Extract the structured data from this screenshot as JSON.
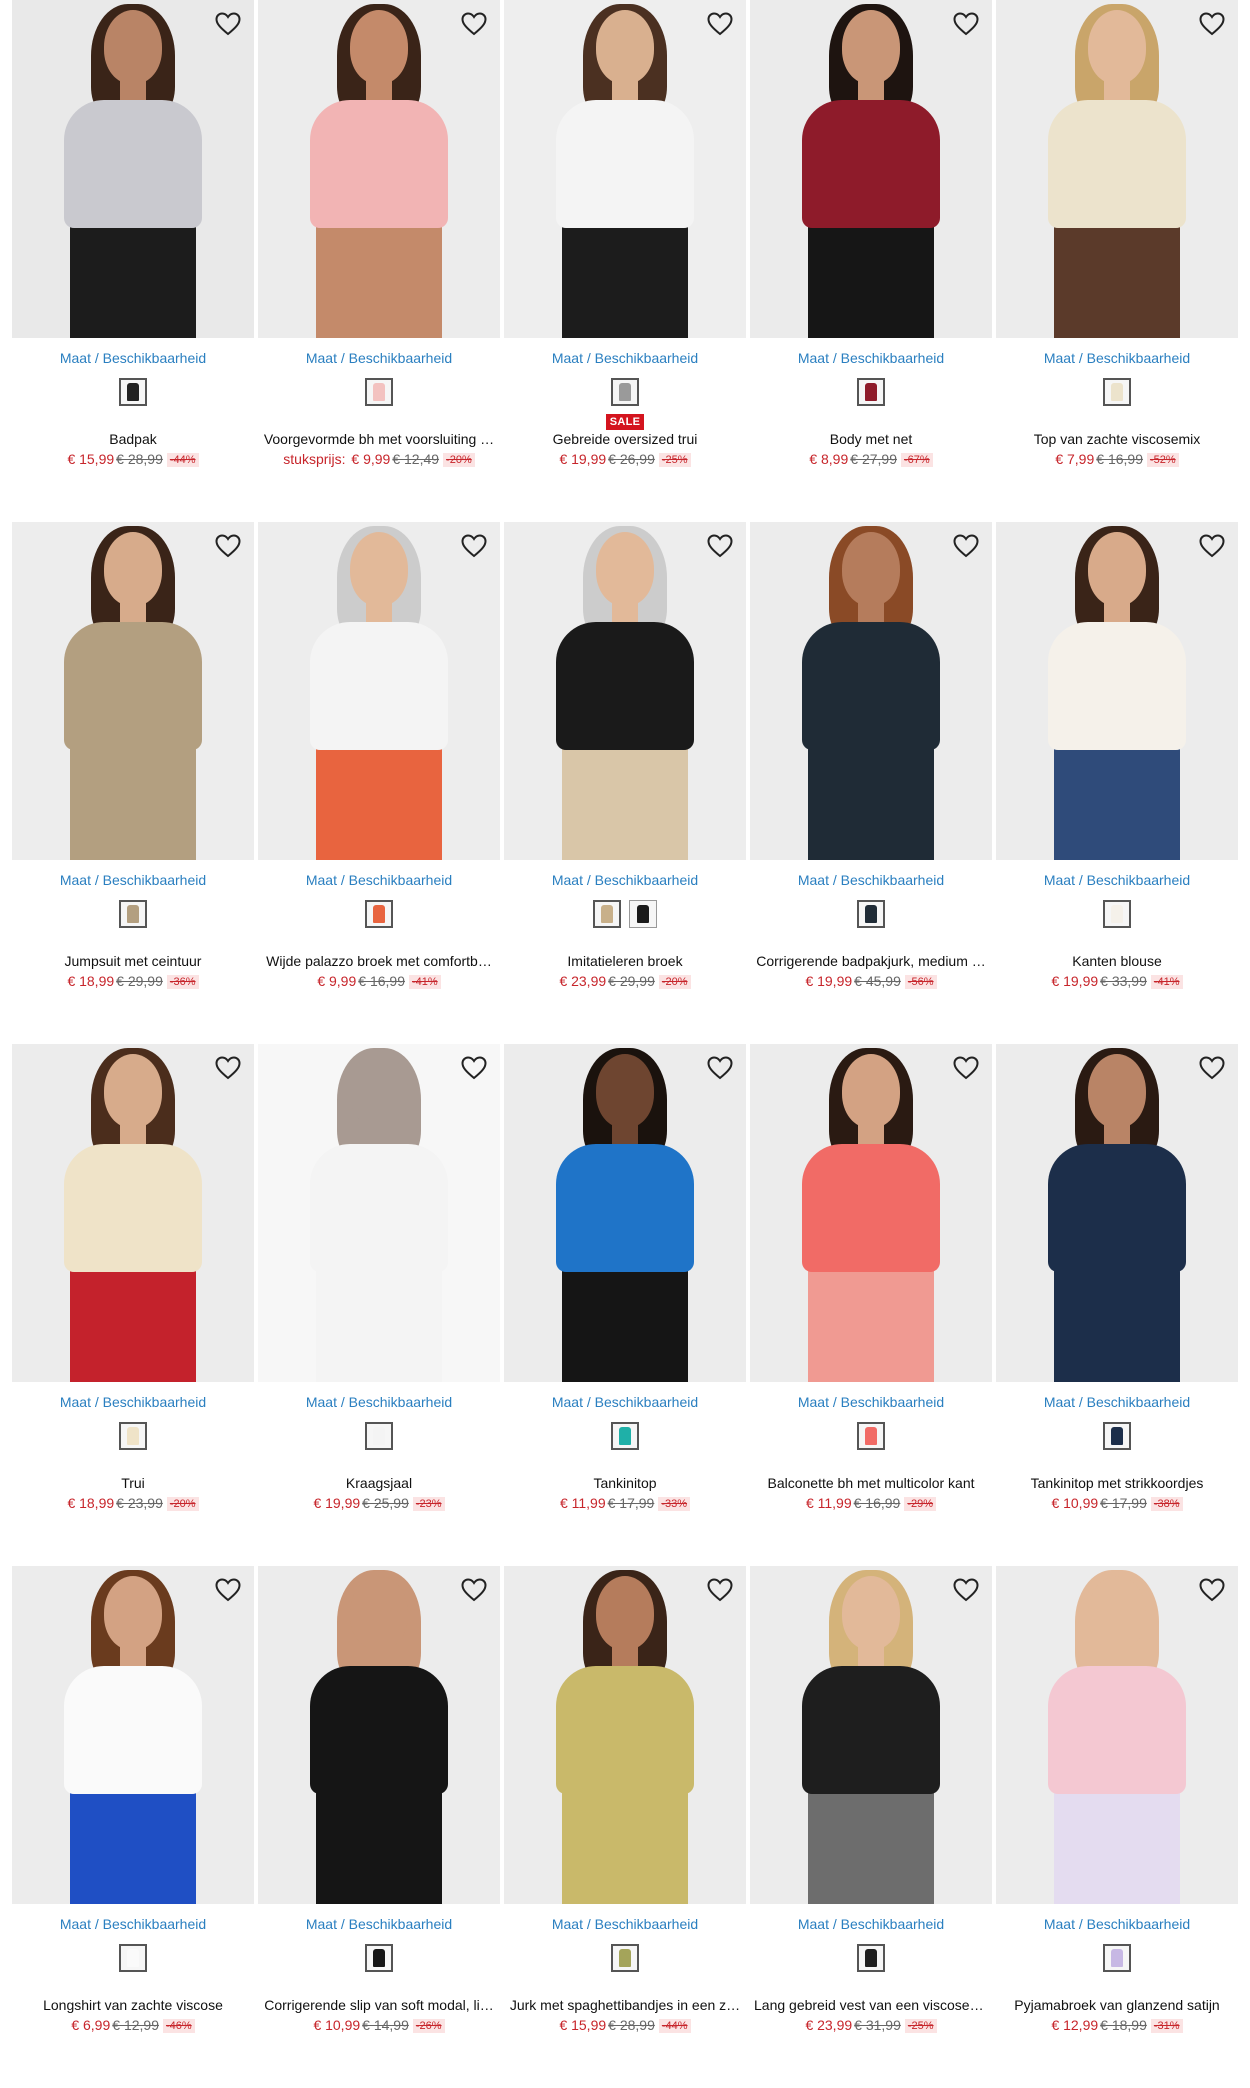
{
  "grid": {
    "size_link_label": "Maat / Beschikbaarheid",
    "products": [
      {
        "title": "Badpak",
        "price_prefix": "",
        "price": "€ 15,99",
        "old_price": "€ 28,99",
        "discount": "-44%",
        "badge": "",
        "img_bg": "#e9e9e9",
        "top": "#c9c9cf",
        "bottom": "#1c1c1c",
        "skin": "#b98466",
        "hair": "#3a2418",
        "swatches": [
          {
            "color": "#222222",
            "selected": true
          }
        ]
      },
      {
        "title": "Voorgevormde bh met voorsluiting …",
        "price_prefix": "stuksprijs:",
        "price": "€ 9,99",
        "old_price": "€ 12,49",
        "discount": "-20%",
        "badge": "",
        "img_bg": "#ececec",
        "top": "#f2b4b4",
        "bottom": "#c48a6a",
        "skin": "#c48a6a",
        "hair": "#3a2418",
        "swatches": [
          {
            "color": "#f3c2c0",
            "selected": true
          }
        ]
      },
      {
        "title": "Gebreide oversized trui",
        "price_prefix": "",
        "price": "€ 19,99",
        "old_price": "€ 26,99",
        "discount": "-25%",
        "badge": "SALE",
        "img_bg": "#eeeeee",
        "top": "#f4f4f4",
        "bottom": "#1c1c1c",
        "skin": "#d9b08f",
        "hair": "#4b3021",
        "swatches": [
          {
            "color": "#9a9a9a",
            "selected": true
          }
        ]
      },
      {
        "title": "Body met net",
        "price_prefix": "",
        "price": "€ 8,99",
        "old_price": "€ 27,99",
        "discount": "-67%",
        "badge": "",
        "img_bg": "#ebebeb",
        "top": "#8e1b2a",
        "bottom": "#161616",
        "skin": "#c99677",
        "hair": "#1e1410",
        "swatches": [
          {
            "color": "#8e1b2a",
            "selected": true
          }
        ]
      },
      {
        "title": "Top van zachte viscosemix",
        "price_prefix": "",
        "price": "€ 7,99",
        "old_price": "€ 16,99",
        "discount": "-52%",
        "badge": "",
        "img_bg": "#ececec",
        "top": "#ece3cc",
        "bottom": "#5b3a2a",
        "skin": "#e2b999",
        "hair": "#c9a56a",
        "swatches": [
          {
            "color": "#ece3cc",
            "selected": true
          }
        ]
      },
      {
        "title": "Jumpsuit met ceintuur",
        "price_prefix": "",
        "price": "€ 18,99",
        "old_price": "€ 29,99",
        "discount": "-36%",
        "badge": "",
        "img_bg": "#ededed",
        "top": "#b39f80",
        "bottom": "#b39f80",
        "skin": "#d7ab8b",
        "hair": "#3a2418",
        "swatches": [
          {
            "color": "#b39f80",
            "selected": true
          }
        ]
      },
      {
        "title": "Wijde palazzo broek met comfortb…",
        "price_prefix": "",
        "price": "€ 9,99",
        "old_price": "€ 16,99",
        "discount": "-41%",
        "badge": "",
        "img_bg": "#ededed",
        "top": "#f4f4f4",
        "bottom": "#e8643f",
        "skin": "#e2b999",
        "hair": "#cccccc",
        "swatches": [
          {
            "color": "#e8643f",
            "selected": true
          }
        ]
      },
      {
        "title": "Imitatieleren broek",
        "price_prefix": "",
        "price": "€ 23,99",
        "old_price": "€ 29,99",
        "discount": "-20%",
        "badge": "",
        "img_bg": "#ededed",
        "top": "#1a1a1a",
        "bottom": "#d9c6a8",
        "skin": "#e2b999",
        "hair": "#cccccc",
        "swatches": [
          {
            "color": "#c8b08a",
            "selected": true
          },
          {
            "color": "#1a1a1a",
            "selected": false
          }
        ]
      },
      {
        "title": "Corrigerende badpakjurk, medium …",
        "price_prefix": "",
        "price": "€ 19,99",
        "old_price": "€ 45,99",
        "discount": "-56%",
        "badge": "",
        "img_bg": "#ececec",
        "top": "#1f2b36",
        "bottom": "#1f2b36",
        "skin": "#b57c5c",
        "hair": "#8a4a26",
        "swatches": [
          {
            "color": "#1f2b36",
            "selected": true
          }
        ]
      },
      {
        "title": "Kanten blouse",
        "price_prefix": "",
        "price": "€ 19,99",
        "old_price": "€ 33,99",
        "discount": "-41%",
        "badge": "",
        "img_bg": "#ececec",
        "top": "#f5f1ea",
        "bottom": "#2f4b7a",
        "skin": "#d8aa8a",
        "hair": "#3a2418",
        "swatches": [
          {
            "color": "#f5f1ea",
            "selected": true
          }
        ]
      },
      {
        "title": "Trui",
        "price_prefix": "",
        "price": "€ 18,99",
        "old_price": "€ 23,99",
        "discount": "-20%",
        "badge": "",
        "img_bg": "#ececec",
        "top": "#efe3c8",
        "bottom": "#c4222c",
        "skin": "#d7ab8b",
        "hair": "#4b2d1c",
        "swatches": [
          {
            "color": "#efe3c8",
            "selected": true
          }
        ]
      },
      {
        "title": "Kraagsjaal",
        "price_prefix": "",
        "price": "€ 19,99",
        "old_price": "€ 25,99",
        "discount": "-23%",
        "badge": "",
        "img_bg": "#f7f7f7",
        "top": "#f4f4f4",
        "bottom": "#f4f4f4",
        "skin": "#a89a92",
        "hair": "#a89a92",
        "swatches": [
          {
            "color": "#f4f4f4",
            "selected": true
          }
        ]
      },
      {
        "title": "Tankinitop",
        "price_prefix": "",
        "price": "€ 11,99",
        "old_price": "€ 17,99",
        "discount": "-33%",
        "badge": "",
        "img_bg": "#ececec",
        "top": "#1f74c8",
        "bottom": "#151515",
        "skin": "#6e4530",
        "hair": "#1a120d",
        "swatches": [
          {
            "color": "#1fb0a8",
            "selected": true
          }
        ]
      },
      {
        "title": "Balconette bh met multicolor kant",
        "price_prefix": "",
        "price": "€ 11,99",
        "old_price": "€ 16,99",
        "discount": "-29%",
        "badge": "",
        "img_bg": "#ececec",
        "top": "#f16b66",
        "bottom": "#f09a92",
        "skin": "#d3a283",
        "hair": "#2a1a12",
        "swatches": [
          {
            "color": "#f16b66",
            "selected": true
          }
        ]
      },
      {
        "title": "Tankinitop met strikkoordjes",
        "price_prefix": "",
        "price": "€ 10,99",
        "old_price": "€ 17,99",
        "discount": "-38%",
        "badge": "",
        "img_bg": "#ececec",
        "top": "#1c2e4a",
        "bottom": "#1c2e4a",
        "skin": "#b98466",
        "hair": "#2a1a12",
        "swatches": [
          {
            "color": "#1c2e4a",
            "selected": true
          }
        ]
      },
      {
        "title": "Longshirt van zachte viscose",
        "price_prefix": "",
        "price": "€ 6,99",
        "old_price": "€ 12,99",
        "discount": "-46%",
        "badge": "",
        "img_bg": "#ececec",
        "top": "#fafafa",
        "bottom": "#1f4fc4",
        "skin": "#d3a283",
        "hair": "#6a3b1e",
        "swatches": [
          {
            "color": "#fafafa",
            "selected": true
          }
        ]
      },
      {
        "title": "Corrigerende slip van soft modal, li…",
        "price_prefix": "",
        "price": "€ 10,99",
        "old_price": "€ 14,99",
        "discount": "-26%",
        "badge": "",
        "img_bg": "#ececec",
        "top": "#151515",
        "bottom": "#151515",
        "skin": "#c99677",
        "hair": "#c99677",
        "swatches": [
          {
            "color": "#151515",
            "selected": true
          }
        ]
      },
      {
        "title": "Jurk met spaghettibandjes in een z…",
        "price_prefix": "",
        "price": "€ 15,99",
        "old_price": "€ 28,99",
        "discount": "-44%",
        "badge": "",
        "img_bg": "#ececec",
        "top": "#c9b96a",
        "bottom": "#c9b96a",
        "skin": "#b57c5c",
        "hair": "#3a2418",
        "swatches": [
          {
            "color": "#a4a45a",
            "selected": true
          }
        ]
      },
      {
        "title": "Lang gebreid vest van een viscosemix",
        "price_prefix": "",
        "price": "€ 23,99",
        "old_price": "€ 31,99",
        "discount": "-25%",
        "badge": "",
        "img_bg": "#ececec",
        "top": "#1e1e1e",
        "bottom": "#6d6d6d",
        "skin": "#e2b999",
        "hair": "#d4b37a",
        "swatches": [
          {
            "color": "#1e1e1e",
            "selected": true
          }
        ]
      },
      {
        "title": "Pyjamabroek van glanzend satijn",
        "price_prefix": "",
        "price": "€ 12,99",
        "old_price": "€ 18,99",
        "discount": "-31%",
        "badge": "",
        "img_bg": "#ececec",
        "top": "#f4c8d2",
        "bottom": "#e4dcf0",
        "skin": "#e2b999",
        "hair": "#e2b999",
        "swatches": [
          {
            "color": "#c7b8e4",
            "selected": true
          }
        ]
      }
    ]
  },
  "icons": {
    "favorite": "heart-outline-icon"
  }
}
